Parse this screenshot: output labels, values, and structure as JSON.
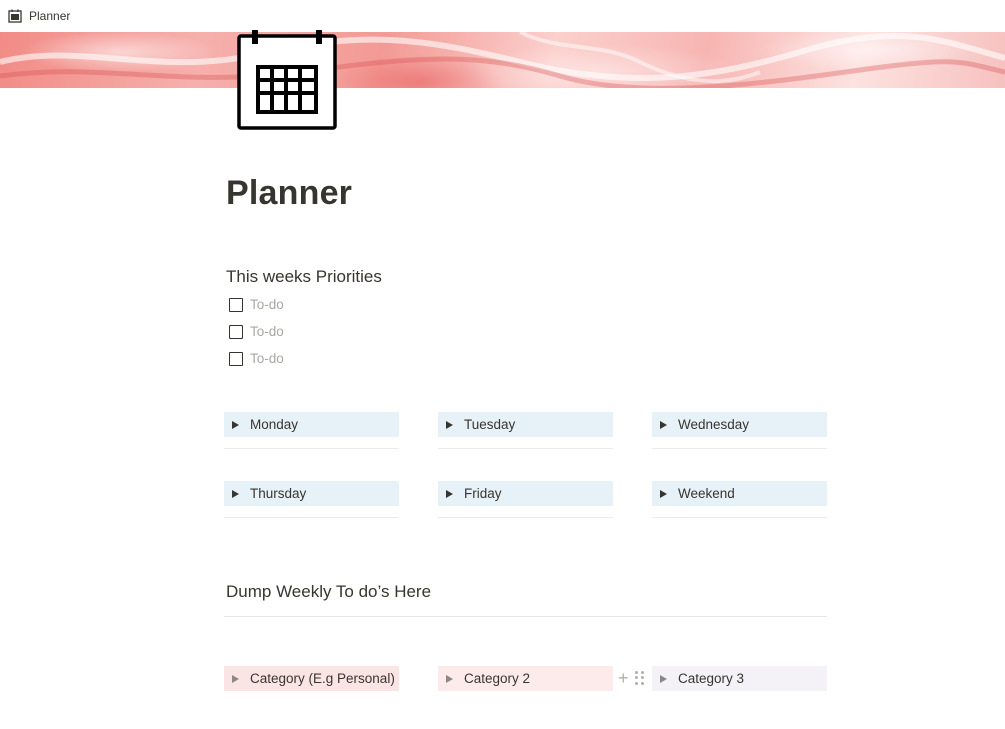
{
  "topbar": {
    "breadcrumb": "Planner",
    "icon": "calendar-icon"
  },
  "cover": {
    "colors": [
      "#f28b86",
      "#f6b0ac",
      "#fbd0cd",
      "#fde2e0"
    ]
  },
  "page": {
    "icon": "calendar-icon",
    "title": "Planner"
  },
  "priorities": {
    "heading": "This weeks Priorities",
    "todos": [
      {
        "placeholder": "To-do",
        "checked": false
      },
      {
        "placeholder": "To-do",
        "checked": false
      },
      {
        "placeholder": "To-do",
        "checked": false
      }
    ]
  },
  "days": [
    {
      "label": "Monday"
    },
    {
      "label": "Tuesday"
    },
    {
      "label": "Wednesday"
    },
    {
      "label": "Thursday"
    },
    {
      "label": "Friday"
    },
    {
      "label": "Weekend"
    }
  ],
  "dump": {
    "heading": "Dump Weekly To do’s Here",
    "categories": [
      {
        "label": "Category (E.g Personal)",
        "color": "#fbe4e4"
      },
      {
        "label": "Category 2",
        "color": "#fdebec"
      },
      {
        "label": "Category 3",
        "color": "#f4f2f6"
      }
    ],
    "hover_tools": {
      "plus": "+",
      "drag": "drag-handle-icon"
    }
  },
  "colors": {
    "toggle_blue": "#e7f1f8",
    "text": "#37352f",
    "placeholder": "#a8a7a4"
  }
}
